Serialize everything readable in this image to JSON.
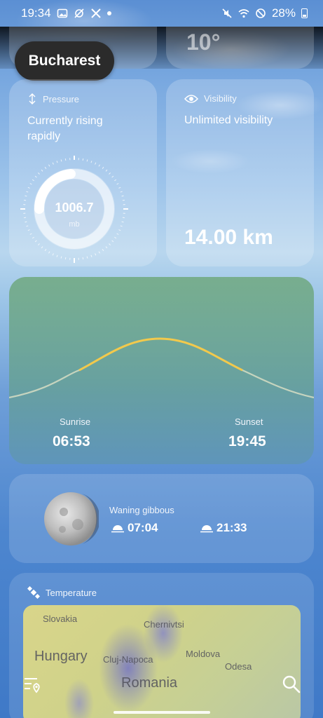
{
  "status_bar": {
    "time": "19:34",
    "battery": "28%"
  },
  "header": {
    "city": "Bucharest",
    "partial_temp": "10°"
  },
  "pressure": {
    "title": "Pressure",
    "description": "Currently rising rapidly",
    "value": "1006.7",
    "unit": "mb"
  },
  "visibility": {
    "title": "Visibility",
    "description": "Unlimited visibility",
    "value": "14.00 km"
  },
  "sun": {
    "sunrise_label": "Sunrise",
    "sunrise_time": "06:53",
    "sunset_label": "Sunset",
    "sunset_time": "19:45"
  },
  "moon": {
    "phase": "Waning gibbous",
    "moonrise": "07:04",
    "moonset": "21:33"
  },
  "temperature": {
    "title": "Temperature",
    "map_labels": [
      "Slovakia",
      "Chernivtsi",
      "Hungary",
      "Cluj-Napoca",
      "Moldova",
      "Odesa",
      "Romania"
    ]
  },
  "colors": {
    "sun_arc": "#f2c94c",
    "city_pill": "#2b2b2b"
  }
}
